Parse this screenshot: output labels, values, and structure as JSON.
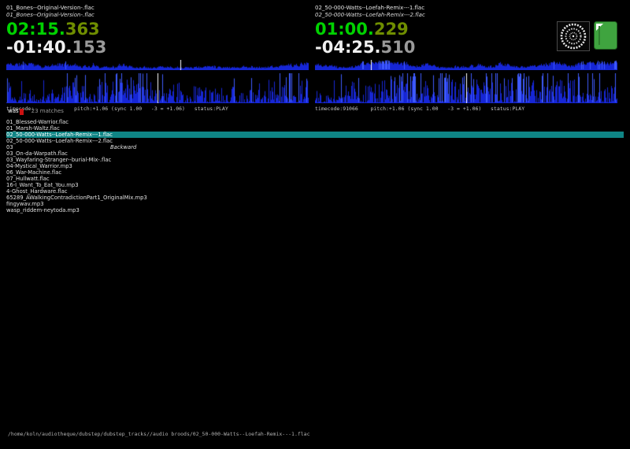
{
  "decks": [
    {
      "track_line1": "01_Bones--Original-Version-.flac",
      "track_line2": "01_Bones--Original-Version-.flac",
      "elapsed": "02:15.",
      "elapsed_frac": "363",
      "remain": "-01:40.",
      "remain_frac": "153",
      "status": "timecode:             pitch:+1.06 (sync 1.00   -3 = +1.06)   status:PLAY",
      "overview_position": 0.575
    },
    {
      "track_line1": "02_50-000-Watts--Loefah-Remix---1.flac",
      "track_line2": "02_50-000-Watts--Loefah-Remix---2.flac",
      "elapsed": "01:00.",
      "elapsed_frac": "229",
      "remain": "-04:25.",
      "remain_frac": "510",
      "status": "timecode:91066    pitch:+1.06 (sync 1.00   -3 = +1.06)   status:PLAY",
      "overview_position": 0.185
    }
  ],
  "search": {
    "query": "was",
    "matches": "23 matches"
  },
  "tracklist": {
    "selected_index": 2,
    "rows": [
      {
        "col1": "01_Blessed-Warrior.flac",
        "col2": ""
      },
      {
        "col1": "01_Marsh-Waltz.flac",
        "col2": ""
      },
      {
        "col1": "02_50-000-Watts--Loefah-Remix---1.flac",
        "col2": ""
      },
      {
        "col1": "02_50-000-Watts--Loefah-Remix---2.flac",
        "col2": ""
      },
      {
        "col1": "03",
        "col2": "Backward"
      },
      {
        "col1": "03_On-da-Warpath.flac",
        "col2": ""
      },
      {
        "col1": "03_Wayfaring-Stranger--burial-Mix-.flac",
        "col2": ""
      },
      {
        "col1": "04-Mystical_Warrior.mp3",
        "col2": ""
      },
      {
        "col1": "06_War-Machine.flac",
        "col2": ""
      },
      {
        "col1": "07_Hullwatt.flac",
        "col2": ""
      },
      {
        "col1": "16-I_Want_To_Eat_You.mp3",
        "col2": ""
      },
      {
        "col1": "4-Ghost_Hardware.flac",
        "col2": ""
      },
      {
        "col1": "65289_AWalkingContradictionPart1_OriginalMix.mp3",
        "col2": ""
      },
      {
        "col1": "fingywav.mp3",
        "col2": ""
      },
      {
        "col1": "wasp_riddem-neytoda.mp3",
        "col2": ""
      }
    ]
  },
  "statusbar": {
    "path": "/home/koln/audiotheque/dubstep/dubstep_tracks//audio broods/02_50-000-Watts--Loefah-Remix---1.flac"
  },
  "icons": {
    "scope": "timecode-scope-icon",
    "green": "green-indicator-icon"
  },
  "colors": {
    "elapsed_green": "#00d200",
    "elapsed_frac": "#6f8e00",
    "remain_white": "#f0f0f0",
    "remain_frac": "#9a9a9a",
    "waveform_blue": "#1626d6",
    "waveform_bright": "#3e5afc",
    "marker_white": "#ffffff",
    "selected_row": "#0f8585",
    "cursor_red": "#cc1111",
    "green_icon": "#3fa43f"
  }
}
